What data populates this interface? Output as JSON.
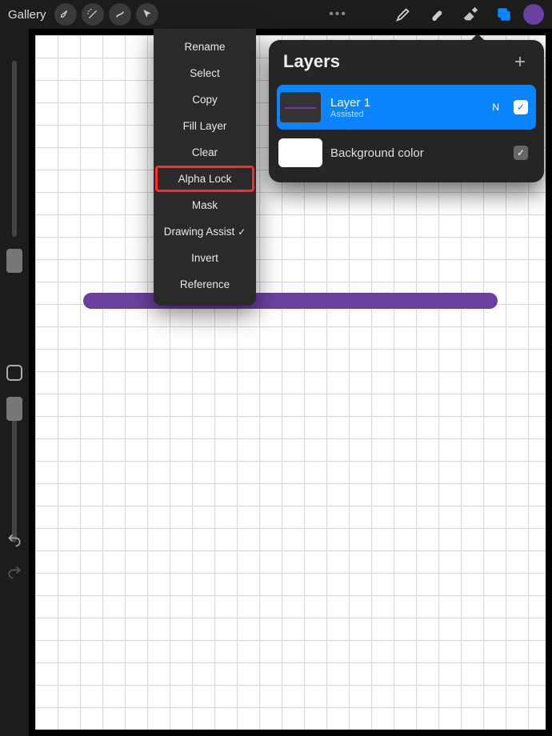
{
  "topbar": {
    "gallery_label": "Gallery"
  },
  "context_menu": {
    "items": [
      {
        "label": "Rename"
      },
      {
        "label": "Select"
      },
      {
        "label": "Copy"
      },
      {
        "label": "Fill Layer"
      },
      {
        "label": "Clear"
      },
      {
        "label": "Alpha Lock",
        "highlighted": true
      },
      {
        "label": "Mask"
      },
      {
        "label": "Drawing Assist",
        "checked": true
      },
      {
        "label": "Invert"
      },
      {
        "label": "Reference"
      }
    ]
  },
  "layers_panel": {
    "title": "Layers",
    "layers": [
      {
        "name": "Layer 1",
        "subtitle": "Assisted",
        "letter": "N",
        "selected": true
      },
      {
        "name": "Background color",
        "selected": false
      }
    ]
  },
  "colors": {
    "accent_purple": "#6b3fa0",
    "accent_blue": "#0a84ff",
    "highlight_red": "#ff2a2a"
  }
}
